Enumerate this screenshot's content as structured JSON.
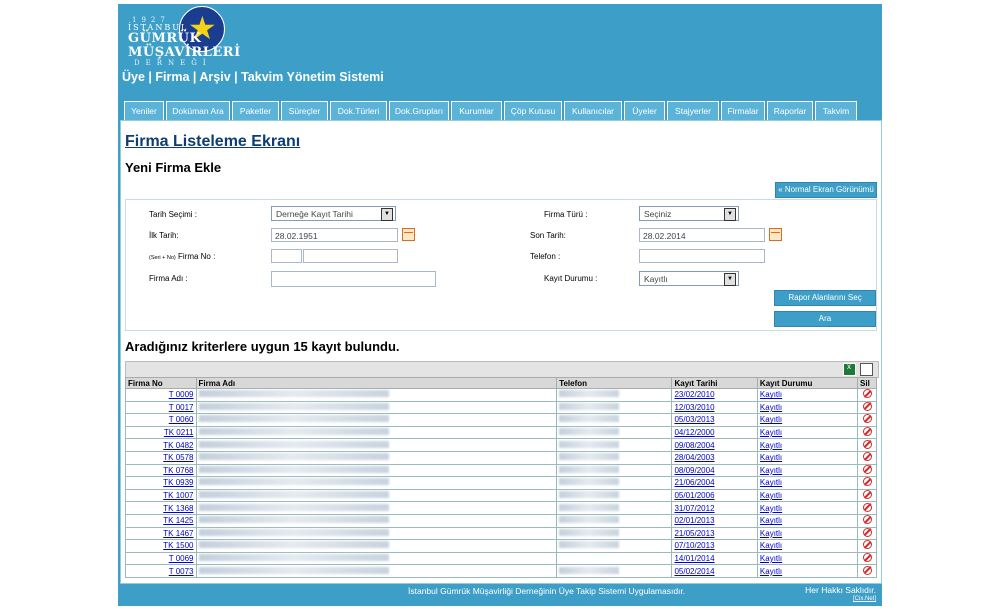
{
  "logo": {
    "year": "1927",
    "line1": "İSTANBUL",
    "line2": "GÜMRÜK",
    "line3": "MÜŞAVİRLERİ",
    "line4": "DERNEĞİ"
  },
  "app_title": "Üye | Firma | Arşiv | Takvim Yönetim Sistemi",
  "tabs": [
    "Yeniler",
    "Doküman Ara",
    "Paketler",
    "Süreçler",
    "Dok.Türleri",
    "Dok.Grupları",
    "Kurumlar",
    "Çöp Kutusu",
    "Kullanıcılar",
    "Üyeler",
    "Stajyerler",
    "Firmalar",
    "Raporlar",
    "Takvim"
  ],
  "page": {
    "title": "Firma Listeleme Ekranı",
    "subtitle": "Yeni Firma Ekle",
    "normal_view_btn": "« Normal Ekran Görünümü"
  },
  "filters": {
    "date_select_label": "Tarih Seçimi :",
    "date_select_value": "Derneğe Kayıt Tarihi",
    "start_label": "İlk Tarih:",
    "start_value": "28.02.1951",
    "serial_small": "(Seri + No)",
    "firm_no_label": "Firma No :",
    "firm_name_label": "Firma Adı :",
    "firm_type_label": "Firma Türü :",
    "firm_type_value": "Seçiniz",
    "end_label": "Son Tarih:",
    "end_value": "28.02.2014",
    "phone_label": "Telefon :",
    "status_label": "Kayıt Durumu :",
    "status_value": "Kayıtlı",
    "report_btn": "Rapor Alanlarını Seç",
    "search_btn": "Ara"
  },
  "results": {
    "title": "Aradığınız kriterlere uygun 15 kayıt bulundu.",
    "columns": [
      "Firma No",
      "Firma Adı",
      "Telefon",
      "Kayıt Tarihi",
      "Kayıt Durumu",
      "Sil"
    ],
    "rows": [
      {
        "no": "T 0009",
        "date": "23/02/2010",
        "status": "Kayıtlı",
        "tel": true
      },
      {
        "no": "T 0017",
        "date": "12/03/2010",
        "status": "Kayıtlı",
        "tel": true
      },
      {
        "no": "T 0060",
        "date": "05/03/2013",
        "status": "Kayıtlı",
        "tel": true
      },
      {
        "no": "TK 0211",
        "date": "04/12/2000",
        "status": "Kayıtlı",
        "tel": true
      },
      {
        "no": "TK 0482",
        "date": "09/08/2004",
        "status": "Kayıtlı",
        "tel": true
      },
      {
        "no": "TK 0578",
        "date": "28/04/2003",
        "status": "Kayıtlı",
        "tel": true
      },
      {
        "no": "TK 0768",
        "date": "08/09/2004",
        "status": "Kayıtlı",
        "tel": true
      },
      {
        "no": "TK 0939",
        "date": "21/06/2004",
        "status": "Kayıtlı",
        "tel": true
      },
      {
        "no": "TK 1007",
        "date": "05/01/2006",
        "status": "Kayıtlı",
        "tel": true
      },
      {
        "no": "TK 1368",
        "date": "31/07/2012",
        "status": "Kayıtlı",
        "tel": true
      },
      {
        "no": "TK 1425",
        "date": "02/01/2013",
        "status": "Kayıtlı",
        "tel": true
      },
      {
        "no": "TK 1467",
        "date": "21/05/2013",
        "status": "Kayıtlı",
        "tel": true
      },
      {
        "no": "TK 1500",
        "date": "07/10/2013",
        "status": "Kayıtlı",
        "tel": true
      },
      {
        "no": "T 0069",
        "date": "14/01/2014",
        "status": "Kayıtlı",
        "tel": false
      },
      {
        "no": "T 0073",
        "date": "05/02/2014",
        "status": "Kayıtlı",
        "tel": true
      }
    ]
  },
  "footer": {
    "center": "İstanbul Gümrük Müşavirliği Derneğinin Üye Takip Sistemi Uygulamasıdır.",
    "rights": "Her Hakkı Saklıdır.",
    "credit": "[Cix.Net]"
  }
}
